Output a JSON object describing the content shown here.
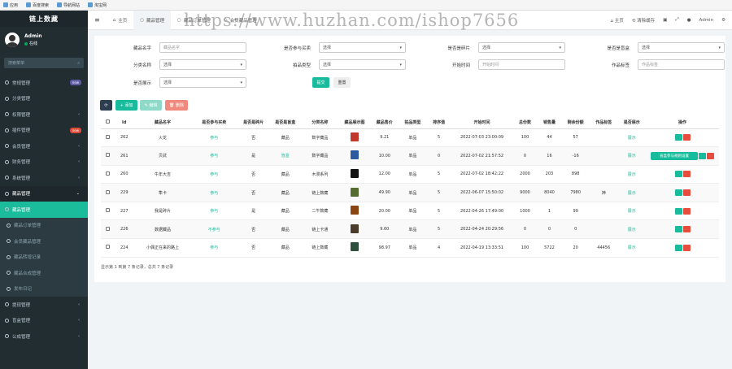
{
  "bookmarks": [
    "应用",
    "百度搜索",
    "导航网站",
    "淘宝网"
  ],
  "sidebar": {
    "logo": "链上数藏",
    "user": {
      "name": "Admin",
      "status": "在线"
    },
    "search_placeholder": "搜索菜单",
    "items": [
      {
        "label": "常规管理",
        "badge": "new",
        "badge_color": "#605ca8",
        "type": "it"
      },
      {
        "label": "分类管理",
        "type": "it"
      },
      {
        "label": "权限管理",
        "arrow": "‹",
        "type": "it"
      },
      {
        "label": "插件管理",
        "badge": "new",
        "badge_color": "#dd4b39",
        "type": "it"
      },
      {
        "label": "会员管理",
        "arrow": "‹",
        "type": "it"
      },
      {
        "label": "财务管理",
        "arrow": "‹",
        "type": "it"
      },
      {
        "label": "系统管理",
        "arrow": "‹",
        "type": "it"
      },
      {
        "label": "藏品管理",
        "arrow": "⌄",
        "type": "it open"
      },
      {
        "label": "藏品管理",
        "type": "it act"
      },
      {
        "label": "藏品订单管理",
        "type": "it sub"
      },
      {
        "label": "会员藏品管理",
        "type": "it sub"
      },
      {
        "label": "藏品转增记录",
        "type": "it sub"
      },
      {
        "label": "藏品合成管理",
        "type": "it sub"
      },
      {
        "label": "发布日记",
        "type": "it sub"
      },
      {
        "label": "提现管理",
        "arrow": "‹",
        "type": "it"
      },
      {
        "label": "盲盒管理",
        "arrow": "‹",
        "type": "it"
      },
      {
        "label": "公成管理",
        "arrow": "‹",
        "type": "it"
      }
    ]
  },
  "topbar": {
    "tabs": [
      "主页",
      "藏品管理",
      "藏品订单管理",
      "会员藏品管理"
    ],
    "right": [
      "主页",
      "清除缓存",
      "Admin"
    ]
  },
  "watermark": "https://www.huzhan.com/ishop7656",
  "filters": [
    [
      {
        "label": "藏品名字",
        "value": "藏品名字",
        "select": false
      },
      {
        "label": "是否参与买卖",
        "value": "选择",
        "select": true
      },
      {
        "label": "是否是碎片",
        "value": "选择",
        "select": true
      },
      {
        "label": "是否是盲盒",
        "value": "选择",
        "select": true
      }
    ],
    [
      {
        "label": "分类名称",
        "value": "选择",
        "select": true
      },
      {
        "label": "拍品类型",
        "value": "选择",
        "select": true
      },
      {
        "label": "开始时间",
        "value": "开始时间",
        "select": false
      },
      {
        "label": "作品标签",
        "value": "作品标签",
        "select": false
      }
    ],
    [
      {
        "label": "是否展示",
        "value": "选择",
        "select": true
      }
    ]
  ],
  "buttons": {
    "submit": "提交",
    "reset": "重置",
    "add": "+ 添加",
    "edit": "✎ 编辑",
    "delete": "🗑 删除"
  },
  "table": {
    "headers": [
      "",
      "Id",
      "藏品名字",
      "是否参与买卖",
      "是否是碎片",
      "是否是盲盒",
      "分类名称",
      "藏品展示图",
      "藏品售价",
      "拍品类型",
      "排序值",
      "开始时间",
      "总份数",
      "销售量",
      "剩余份额",
      "作品标签",
      "是否展示",
      "操作"
    ],
    "rows": [
      [
        "262",
        "火龙",
        "参与",
        "否",
        "藏品",
        "数字藏品",
        "#c0392b",
        "9.21",
        "单品",
        "5",
        "2022-07-03 23:00:09",
        "100",
        "44",
        "57",
        "",
        "展示"
      ],
      [
        "261",
        "贝武",
        "参与",
        "是",
        "盲盒",
        "数字藏品",
        "#2c5aa0",
        "10.00",
        "单品",
        "0",
        "2022-07-02 21:57:52",
        "0",
        "16",
        "-16",
        "",
        "展示"
      ],
      [
        "260",
        "牛年大吉",
        "参与",
        "否",
        "藏品",
        "木漫系列",
        "#111111",
        "12.00",
        "单品",
        "5",
        "2022-07-02 18:42:22",
        "2000",
        "203",
        "898",
        "",
        "展示"
      ],
      [
        "229",
        "隼卡",
        "参与",
        "否",
        "藏品",
        "链上数藏",
        "#556b2f",
        "49.90",
        "单品",
        "5",
        "2022-06-07 15:50:02",
        "9000",
        "8040",
        "7980",
        "神",
        "展示"
      ],
      [
        "227",
        "我是碎片",
        "参与",
        "是",
        "藏品",
        "二牛数藏",
        "#8b4513",
        "20.00",
        "单品",
        "5",
        "2022-04-26 17:49:00",
        "1000",
        "1",
        "99",
        "",
        "展示"
      ],
      [
        "226",
        "数据藏品",
        "不参与",
        "否",
        "藏品",
        "链上卡通",
        "#4a3b2a",
        "9.60",
        "单品",
        "5",
        "2022-04-24 20:29:56",
        "0",
        "0",
        "0",
        "",
        "展示"
      ],
      [
        "224",
        "小偶正在来的路上",
        "参与",
        "否",
        "藏品",
        "链上数藏",
        "#2e4e3e",
        "98.97",
        "单品",
        "4",
        "2022-04-19 13:33:51",
        "100",
        "5722",
        "20",
        "44456",
        "展示"
      ]
    ],
    "special_action": "盲盒参与规则设置"
  },
  "footer": "显示第 1 到第 7 条记录，总共 7 条记录"
}
